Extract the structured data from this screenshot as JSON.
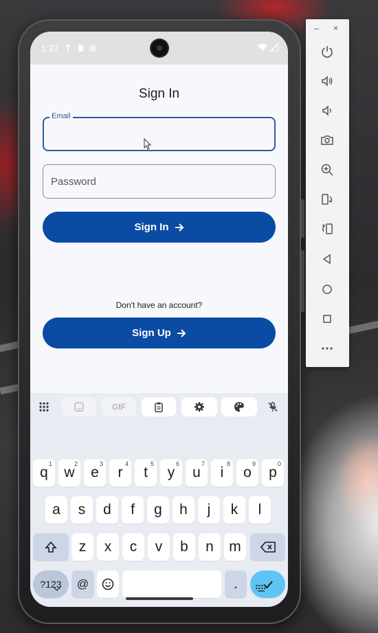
{
  "status_bar": {
    "time": "1:27"
  },
  "screen": {
    "title": "Sign In",
    "email": {
      "label": "Email",
      "value": ""
    },
    "password": {
      "placeholder": "Password"
    },
    "sign_in_button": "Sign In",
    "no_account_text": "Don't have an account?",
    "sign_up_button": "Sign Up"
  },
  "keyboard": {
    "toolbar": {
      "gif_label": "GIF"
    },
    "row1": [
      {
        "key": "q",
        "hint": "1"
      },
      {
        "key": "w",
        "hint": "2"
      },
      {
        "key": "e",
        "hint": "3"
      },
      {
        "key": "r",
        "hint": "4"
      },
      {
        "key": "t",
        "hint": "5"
      },
      {
        "key": "y",
        "hint": "6"
      },
      {
        "key": "u",
        "hint": "7"
      },
      {
        "key": "i",
        "hint": "8"
      },
      {
        "key": "o",
        "hint": "9"
      },
      {
        "key": "p",
        "hint": "0"
      }
    ],
    "row2": [
      "a",
      "s",
      "d",
      "f",
      "g",
      "h",
      "j",
      "k",
      "l"
    ],
    "row3": [
      "z",
      "x",
      "c",
      "v",
      "b",
      "n",
      "m"
    ],
    "symbols_key": "?123",
    "at_key": "@",
    "period_key": "."
  },
  "emulator_toolbar": {
    "minimize": "–",
    "close": "×",
    "icons": [
      "power-icon",
      "volume-up-icon",
      "volume-down-icon",
      "camera-icon",
      "zoom-in-icon",
      "rotate-left-icon",
      "rotate-right-icon",
      "back-icon",
      "home-icon",
      "overview-icon",
      "more-icon"
    ]
  },
  "colors": {
    "primary": "#0a4ba3",
    "focus_outline": "#2c5aa0",
    "enter_key": "#5ec4f5"
  }
}
